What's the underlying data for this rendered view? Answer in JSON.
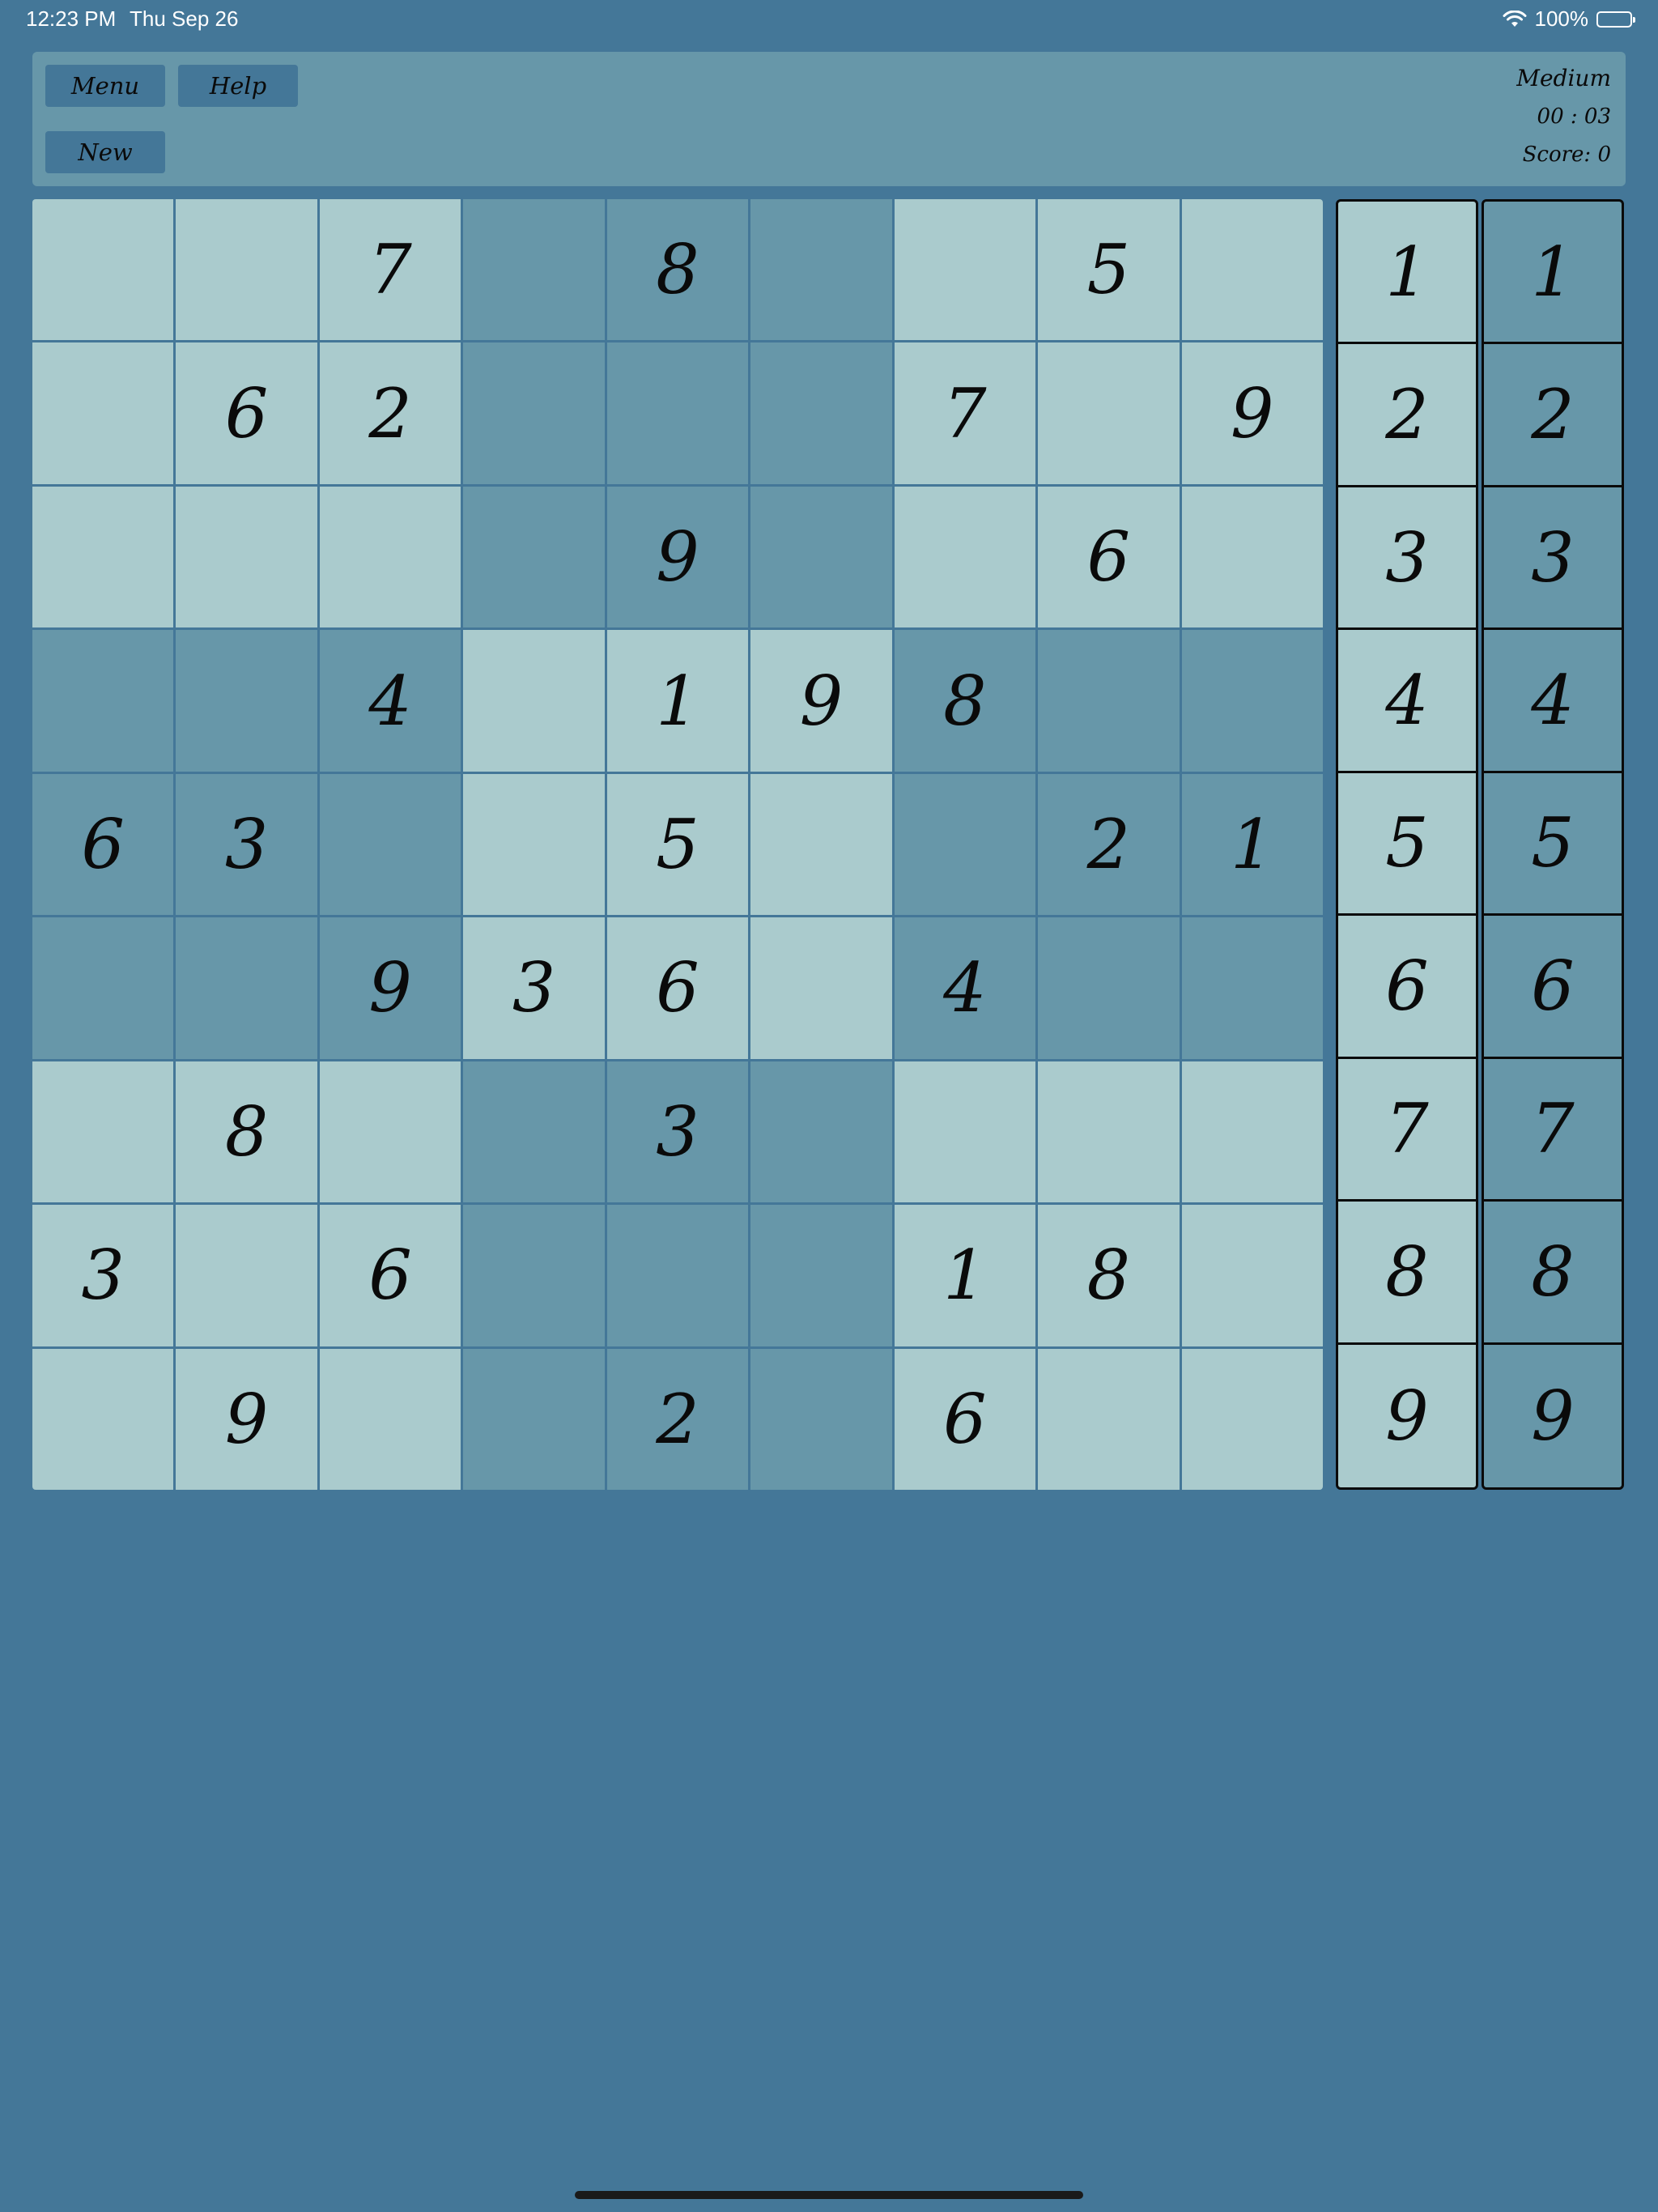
{
  "status_bar": {
    "time": "12:23 PM",
    "date": "Thu Sep 26",
    "battery": "100%"
  },
  "header": {
    "menu_label": "Menu",
    "help_label": "Help",
    "new_label": "New",
    "difficulty": "Medium",
    "timer": "00 : 03",
    "score": "Score: 0"
  },
  "board": {
    "rows": [
      [
        "",
        "",
        "7",
        "",
        "8",
        "",
        "",
        "5",
        ""
      ],
      [
        "",
        "6",
        "2",
        "",
        "",
        "",
        "7",
        "",
        "9"
      ],
      [
        "",
        "",
        "",
        "",
        "9",
        "",
        "",
        "6",
        ""
      ],
      [
        "",
        "",
        "4",
        "",
        "1",
        "9",
        "8",
        "",
        ""
      ],
      [
        "6",
        "3",
        "",
        "",
        "5",
        "",
        "",
        "2",
        "1"
      ],
      [
        "",
        "",
        "9",
        "3",
        "6",
        "",
        "4",
        "",
        ""
      ],
      [
        "",
        "8",
        "",
        "",
        "3",
        "",
        "",
        "",
        ""
      ],
      [
        "3",
        "",
        "6",
        "",
        "",
        "",
        "1",
        "8",
        ""
      ],
      [
        "",
        "9",
        "",
        "",
        "2",
        "",
        "6",
        "",
        ""
      ]
    ]
  },
  "number_pad_left": [
    "1",
    "2",
    "3",
    "4",
    "5",
    "6",
    "7",
    "8",
    "9"
  ],
  "number_pad_right": [
    "1",
    "2",
    "3",
    "4",
    "5",
    "6",
    "7",
    "8",
    "9"
  ],
  "colors": {
    "background": "#447798",
    "panel": "#6797a9",
    "cell_light": "#aacbcd",
    "cell_dark": "#6797a9"
  }
}
